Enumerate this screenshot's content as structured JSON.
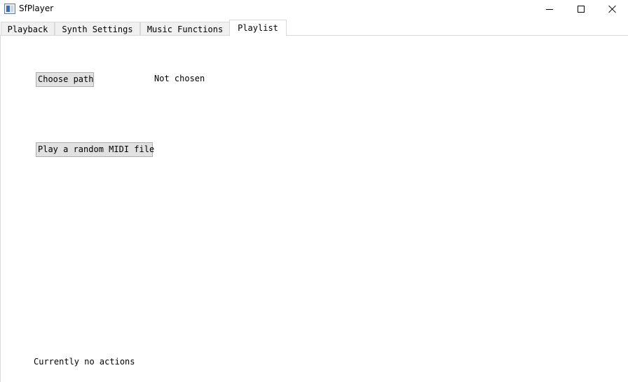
{
  "window": {
    "title": "SfPlayer",
    "controls": {
      "minimize": "minimize-icon",
      "maximize": "maximize-icon",
      "close": "close-icon"
    }
  },
  "tabs": [
    {
      "label": "Playback"
    },
    {
      "label": "Synth Settings"
    },
    {
      "label": "Music Functions"
    },
    {
      "label": "Playlist",
      "active": true
    }
  ],
  "playlist": {
    "choose_path_label": "Choose path",
    "path_value": "Not chosen",
    "play_random_label": "Play a random MIDI file"
  },
  "status": {
    "text": "Currently no actions"
  }
}
